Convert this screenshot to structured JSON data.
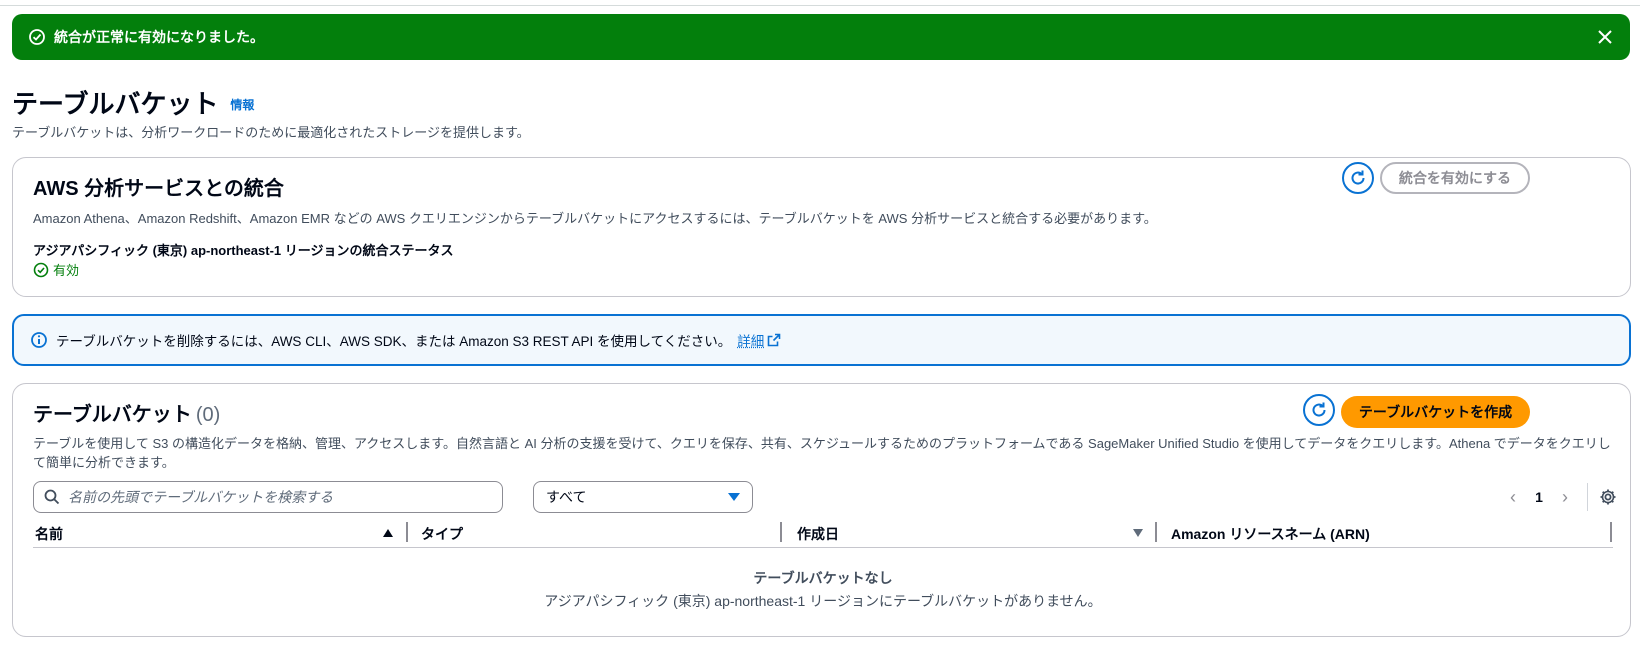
{
  "flash": {
    "message": "統合が正常に有効になりました。",
    "type": "success",
    "color": "#037f0c"
  },
  "page": {
    "title": "テーブルバケット",
    "info_link": "情報",
    "description": "テーブルバケットは、分析ワークロードのために最適化されたストレージを提供します。"
  },
  "integration": {
    "title": "AWS 分析サービスとの統合",
    "description": "Amazon Athena、Amazon Redshift、Amazon EMR などの AWS クエリエンジンからテーブルバケットにアクセスするには、テーブルバケットを AWS 分析サービスと統合する必要があります。",
    "status_label": "アジアパシフィック (東京) ap-northeast-1 リージョンの統合ステータス",
    "status_value": "有効",
    "enable_button": "統合を有効にする"
  },
  "alert": {
    "text": "テーブルバケットを削除するには、AWS CLI、AWS SDK、または Amazon S3 REST API を使用してください。",
    "link": "詳細"
  },
  "buckets": {
    "title": "テーブルバケット",
    "count": "(0)",
    "description": "テーブルを使用して S3 の構造化データを格納、管理、アクセスします。自然言語と AI 分析の支援を受けて、クエリを保存、共有、スケジュールするためのプラットフォームである SageMaker Unified Studio を使用してデータをクエリします。Athena でデータをクエリして簡単に分析できます。",
    "create_button": "テーブルバケットを作成",
    "search_placeholder": "名前の先頭でテーブルバケットを検索する",
    "filter_selected": "すべて",
    "page_number": "1",
    "columns": [
      "名前",
      "タイプ",
      "作成日",
      "Amazon リソースネーム (ARN)"
    ],
    "empty_title": "テーブルバケットなし",
    "empty_description": "アジアパシフィック (東京) ap-northeast-1 リージョンにテーブルバケットがありません。"
  },
  "colors": {
    "primary": "#ff9900",
    "link": "#0972d3",
    "success": "#037f0c"
  }
}
